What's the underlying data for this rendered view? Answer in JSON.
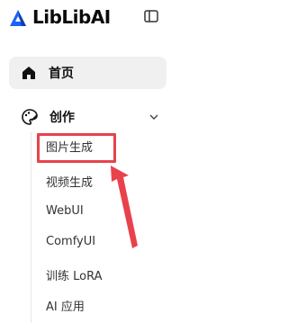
{
  "app": {
    "logo_text": "LibLibAI",
    "brand_color": "#1c62f4"
  },
  "icons": {
    "collapse": "sidebar-collapse-icon",
    "home": "home-icon",
    "create": "palette-brush-icon",
    "chevron": "chevron-down-icon"
  },
  "nav": {
    "home_label": "首页",
    "create_label": "创作",
    "create_items": [
      {
        "label": "图片生成"
      },
      {
        "label": "视频生成"
      },
      {
        "label": "WebUI"
      },
      {
        "label": "ComfyUI"
      },
      {
        "label": "训练 LoRA"
      },
      {
        "label": "AI 应用"
      }
    ]
  },
  "annotation": {
    "color": "#e8424c",
    "target": "图片生成"
  }
}
